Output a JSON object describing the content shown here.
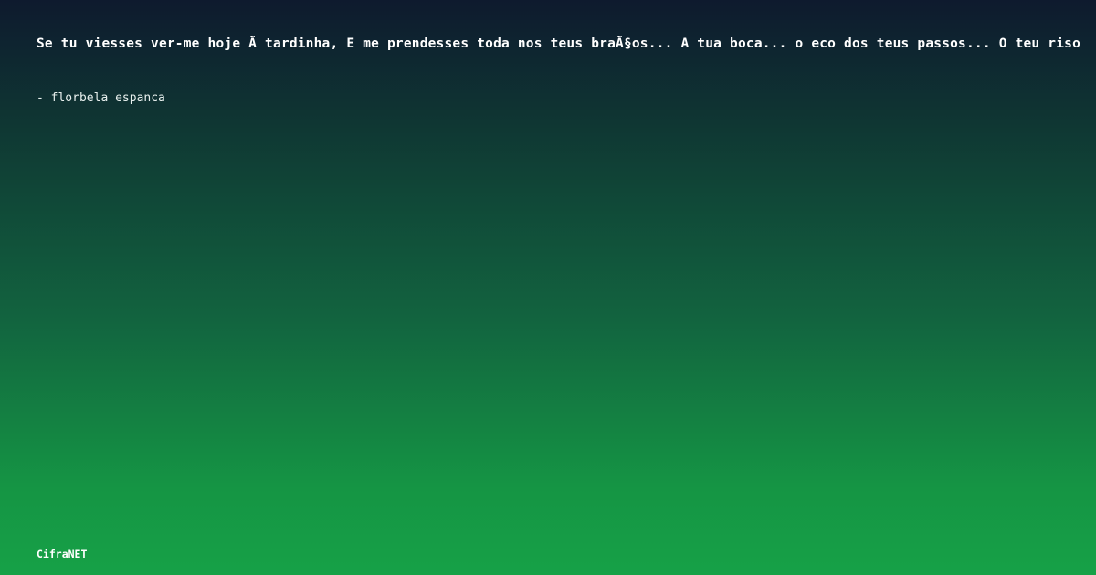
{
  "quote": {
    "text": "Se tu viesses ver-me hoje Ã  tardinha, E me prendesses toda nos teus braÃ§os... A tua boca... o eco dos teus passos... O teu riso"
  },
  "author": {
    "text": "- florbela espanca"
  },
  "brand": {
    "name": "CifraNET"
  }
}
